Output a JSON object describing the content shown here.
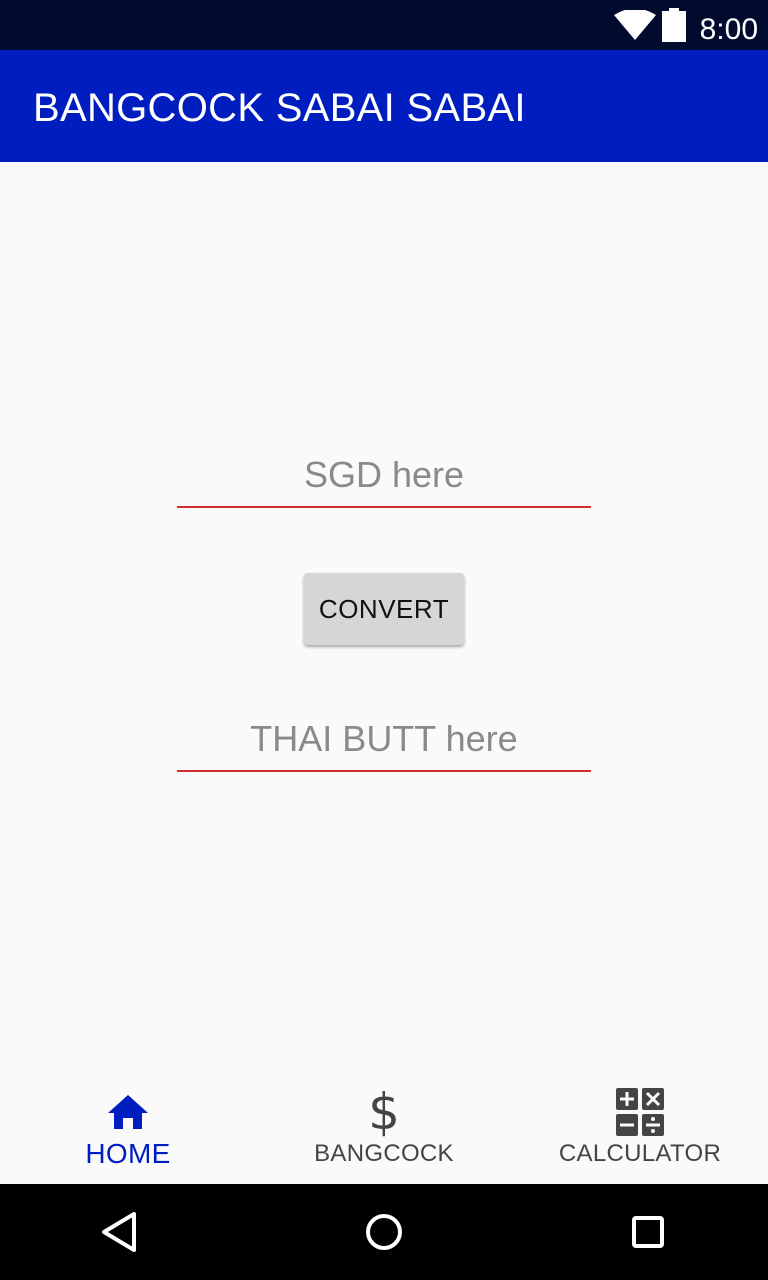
{
  "status_bar": {
    "time": "8:00",
    "wifi_icon": "wifi-icon",
    "battery_icon": "battery-icon"
  },
  "app_bar": {
    "title": "BANGCOCK SABAI SABAI"
  },
  "form": {
    "sgd_value": "",
    "sgd_placeholder": "SGD here",
    "convert_label": "CONVERT",
    "thb_value": "",
    "thb_placeholder": "THAI BUTT here"
  },
  "bottom_nav": {
    "items": [
      {
        "label": "HOME",
        "icon": "home-icon",
        "selected": true
      },
      {
        "label": "BANGCOCK",
        "icon": "dollar-icon",
        "selected": false
      },
      {
        "label": "CALCULATOR",
        "icon": "calculator-icon",
        "selected": false
      }
    ]
  },
  "colors": {
    "app_bar": "#001ebf",
    "status_bar": "#000b2e",
    "accent_underline": "#d32f2f",
    "selected_nav": "#001ebf"
  }
}
